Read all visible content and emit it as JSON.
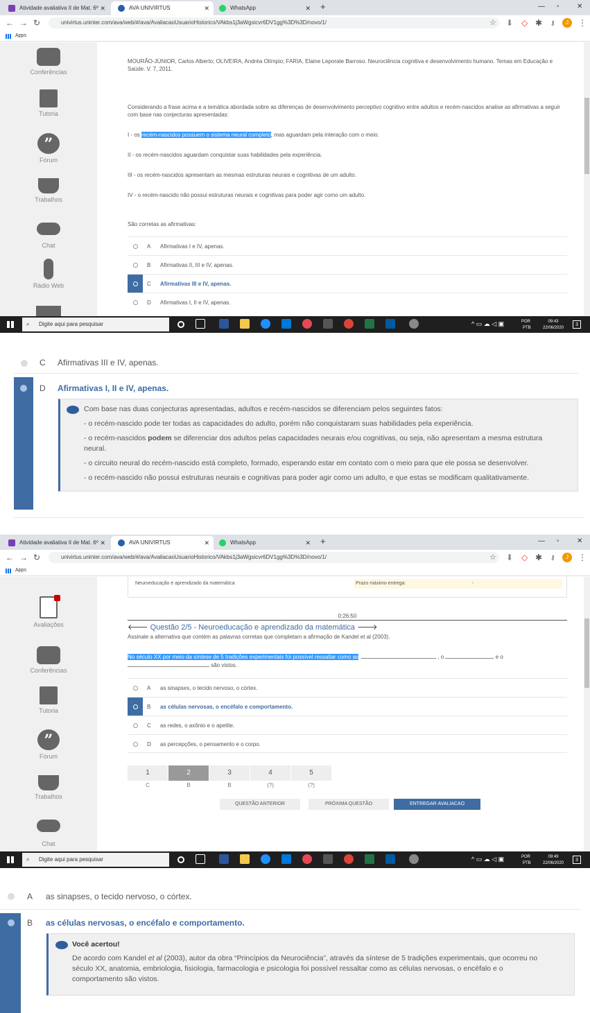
{
  "browser": {
    "tabs": [
      "Atividade avaliativa II de Mat. 6º",
      "AVA UNIVIRTUS",
      "WhatsApp"
    ],
    "url": "univirtus.uninter.com/ava/web/#/ava/AvaliacaoUsuarioHistorico/VAkbs1j3aWgsicvr6DV1gg%3D%3D/novo/1/",
    "apps_label": "Apps",
    "avatar_letter": "J"
  },
  "sidebar": {
    "s1": [
      "Conferências",
      "Tutoria",
      "Fórum",
      "Trabalhos",
      "Chat",
      "Rádio Web"
    ],
    "s2": [
      "Avaliações",
      "Conferências",
      "Tutoria",
      "Fórum",
      "Trabalhos",
      "Chat"
    ]
  },
  "q1": {
    "reference": "MOURÃO-JÚNIOR, Carlos Alberto; OLIVEIRA, Andréa Olímpio; FARIA, Elaine Leporate Barroso. Neurociência cognitiva e desenvolvimento humano. Temas em Educação e Saúde. V. 7, 2011.",
    "prompt": "Considerando a frase acima e a temática abordada sobre as diferenças de desenvolvimento perceptivo cognitivo entre adultos e recém-nascidos analise as afirmativas a seguir com base nas conjecturas apresentadas:",
    "s1_pre": "I - os ",
    "s1_hl": "recém-nascidos possuem o sistema neural completo",
    "s1_post": ", mas aguardam pela interação com o meio.",
    "s2": "II - os recém-nascidos aguardam conquistar suas habilidades pela experiência.",
    "s3": "III - os recém-nascidos apresentam as mesmas estruturas neurais e cognitivas de um adulto.",
    "s4": "IV - o recém-nascido não possui estruturas neurais e cognitivas para poder agir como um adulto.",
    "correct_label": "São corretas as afirmativas:",
    "options": [
      {
        "letter": "A",
        "text": "Afirmativas I e IV, apenas."
      },
      {
        "letter": "B",
        "text": "Afirmativas II, III e IV, apenas."
      },
      {
        "letter": "C",
        "text": "Afirmativas III e IV, apenas."
      },
      {
        "letter": "D",
        "text": "Afirmativas I, II e IV, apenas."
      }
    ],
    "selected": "C"
  },
  "taskbar": {
    "search": "Digite aqui para pesquisar",
    "lang": "POR",
    "lang2": "PTB",
    "time1": "09:43",
    "time2": "09:49",
    "date": "22/06/2020",
    "notif": "3"
  },
  "zoom1": {
    "c_letter": "C",
    "c_text": "Afirmativas III e IV, apenas.",
    "d_letter": "D",
    "d_text": "Afirmativas I, II e IV, apenas.",
    "fb_title": "Com base nas duas conjecturas apresentadas, adultos e recém-nascidos se diferenciam pelos seguintes fatos:",
    "fb1": "- o recém-nascido pode ter todas as capacidades do adulto, porém não conquistaram suas habilidades pela experiência.",
    "fb2a": "- o recém-nascidos ",
    "fb2b": "podem",
    "fb2c": " se diferenciar dos adultos pelas capacidades neurais e/ou cognitivas, ou seja, não apresentam a mesma estrutura",
    "fb2d": "neural.",
    "fb3": "- o circuito neural do recém-nascido está completo, formado, esperando estar em contato com o meio para que ele possa se desenvolver.",
    "fb4": "- o recém-nascido não possui estruturas neurais e cognitivas para poder agir como um adulto, e que estas se modificam qualitativamente."
  },
  "q2": {
    "info_left": "Neuroeducação e aprendizado da matemática",
    "info_right": "Prazo máximo entrega:",
    "info_dash": "-",
    "timer": "0:26:50",
    "title": "Questão 2/5 - Neuroeducação e aprendizado da matemática",
    "instruction": "Assinale a alternativa que contém as palavras corretas que completam a afirmação de Kandel et al (2003).",
    "stmt_hl": "No século XX por meio da síntese de 5 tradições experimentais foi possível ressaltar como as",
    "stmt_o": ", o",
    "stmt_eo": "e o",
    "stmt_end": "são vistos.",
    "options": [
      {
        "letter": "A",
        "text": "as sinapses, o tecido nervoso, o córtex."
      },
      {
        "letter": "B",
        "text": "as células nervosas, o encéfalo e comportamento."
      },
      {
        "letter": "C",
        "text": "as redes, o axônio e o apetite."
      },
      {
        "letter": "D",
        "text": "as percepções, o pensamento e o corpo."
      }
    ],
    "pages": [
      {
        "n": "1",
        "a": "C"
      },
      {
        "n": "2",
        "a": "B"
      },
      {
        "n": "3",
        "a": "B"
      },
      {
        "n": "4",
        "a": "(?)"
      },
      {
        "n": "5",
        "a": "(?)"
      }
    ],
    "btn_prev": "QUESTÃO ANTERIOR",
    "btn_next": "PRÓXIMA QUESTÃO",
    "btn_submit": "ENTREGAR AVALIACAO"
  },
  "zoom2": {
    "a_letter": "A",
    "a_text": "as sinapses, o tecido nervoso, o córtex.",
    "b_letter": "B",
    "b_text": "as células nervosas, o encéfalo e comportamento.",
    "fb_title": "Você acertou!",
    "fb_a": "De acordo com Kandel ",
    "fb_b": "et al",
    "fb_c": " (2003), autor da obra “Princípios da Neurociência”, através da síntese de 5 tradições experimentais, que ocorreu no",
    "fb_d": "século XX, anatomia, embriologia, fisiologia, farmacologia e psicologia foi possível ressaltar como as células nervosas, o encéfalo e o",
    "fb_e": "comportamento são vistos."
  }
}
